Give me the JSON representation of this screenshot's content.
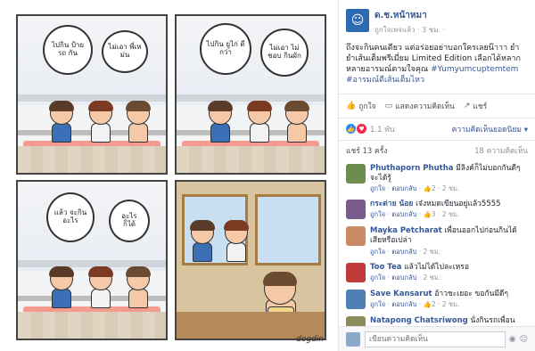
{
  "post": {
    "page_name": "ด.ช.หน้าหมา",
    "time": "ถูกใจเพจแล้ว · 3 ชม. ·",
    "text": "ถึงจะกินคนเดียว แต่อร่อยอย่าบอกใครเลยน๊าาา ยำยำเส้นเต็มพรีเมี่ยม Limited Edition เลือกได้หลากหลายอารมณ์ตามใจคุณ",
    "hashtags": "#Yumyumcuptemtem #อารมณ์ดีเส้นเต็มไหว",
    "actions": [
      {
        "icon": "like-icon",
        "label": "ถูกใจ"
      },
      {
        "icon": "comment-icon",
        "label": "แสดงความคิดเห็น"
      },
      {
        "icon": "share-icon",
        "label": "แชร์"
      }
    ],
    "reaction_count": "1.1 พัน",
    "sort_label": "ความคิดเห็นยอดนิยม ▾",
    "shares": "แชร์ 13 ครั้ง",
    "comments_count": "18 ความคิดเห็น"
  },
  "comments": [
    {
      "name": "Phuthaporn Phutha",
      "text": "มีลิงค์ก็ไม่บอกกันดีๆ จะได้รู้",
      "reply": "ตอบกลับ",
      "like": "ถูกใจ",
      "likes": "2",
      "time": "2 ชม.",
      "avatar_color": "#6b8e4e"
    },
    {
      "name": "กระต่าย น้อย",
      "text": "เจ๋งหมดเขียนอยู่แล้ว5555",
      "reply": "ตอบกลับ",
      "like": "ถูกใจ",
      "likes": "3",
      "time": "2 ชม.",
      "avatar_color": "#7a5c8c"
    },
    {
      "name": "Mayka Petcharat",
      "text": "เพื่อนออกไปก่อนกินได้เสียหรือเปล่า",
      "reply": "ตอบกลับ",
      "like": "ถูกใจ",
      "likes": "",
      "time": "2 ชม.",
      "avatar_color": "#c98a64"
    },
    {
      "name": "Too Tea",
      "text": "แล้วไม่ได้ไปละเหรอ",
      "reply": "ตอบกลับ",
      "like": "ถูกใจ",
      "likes": "",
      "time": "2 ชม.",
      "avatar_color": "#c03a3a"
    },
    {
      "name": "Save Kansarut",
      "text": "อ้าวชะเยอะ ขอกันมีดีๆ",
      "reply": "ตอบกลับ",
      "like": "ถูกใจ",
      "likes": "2",
      "time": "2 ชม.",
      "avatar_color": "#4f7fb3"
    },
    {
      "name": "Natapong Chatsriwong",
      "text": "นั่งกินรถเพื่อนหน้า",
      "reply": "",
      "like": "",
      "likes": "",
      "time": "",
      "avatar_color": "#8c8c5a"
    }
  ],
  "composer": {
    "placeholder": "เขียนความคิดเห็น"
  },
  "comic": {
    "bubbles": {
      "p1_a": "ไปกิน ป้ายรถ กัน",
      "p1_b": "ไม่เอา พี่เหม่น",
      "p2_a": "ไปกิน ยูไก่ ดีกว่า",
      "p2_b": "ไม่เอา ไม่ชอบ กินผัก",
      "p3_a": "แล้ว จะกิน อะไร",
      "p3_b": "อะไร ก็ได้"
    },
    "signature": "dogdin"
  }
}
